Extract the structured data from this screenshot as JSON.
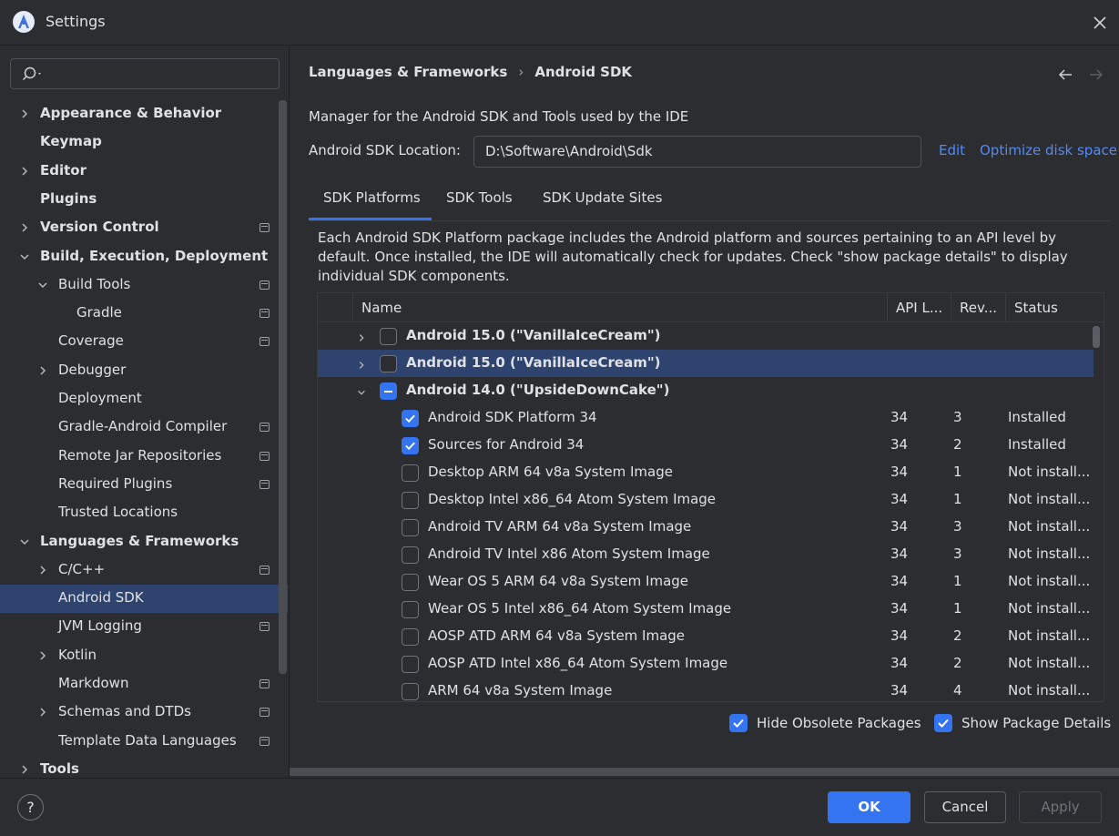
{
  "window": {
    "title": "Settings"
  },
  "search": {
    "placeholder": ""
  },
  "sidebar": {
    "items": [
      {
        "label": "Appearance & Behavior",
        "depth": 0,
        "arrow": "right",
        "bold": true,
        "badge": false
      },
      {
        "label": "Keymap",
        "depth": 0,
        "arrow": "none",
        "bold": true,
        "badge": false
      },
      {
        "label": "Editor",
        "depth": 0,
        "arrow": "right",
        "bold": true,
        "badge": false
      },
      {
        "label": "Plugins",
        "depth": 0,
        "arrow": "none",
        "bold": true,
        "badge": false
      },
      {
        "label": "Version Control",
        "depth": 0,
        "arrow": "right",
        "bold": true,
        "badge": true
      },
      {
        "label": "Build, Execution, Deployment",
        "depth": 0,
        "arrow": "down",
        "bold": true,
        "badge": false
      },
      {
        "label": "Build Tools",
        "depth": 1,
        "arrow": "down",
        "bold": false,
        "badge": true
      },
      {
        "label": "Gradle",
        "depth": 2,
        "arrow": "none",
        "bold": false,
        "badge": true
      },
      {
        "label": "Coverage",
        "depth": 1,
        "arrow": "none",
        "bold": false,
        "badge": true
      },
      {
        "label": "Debugger",
        "depth": 1,
        "arrow": "right",
        "bold": false,
        "badge": false
      },
      {
        "label": "Deployment",
        "depth": 1,
        "arrow": "none",
        "bold": false,
        "badge": false
      },
      {
        "label": "Gradle-Android Compiler",
        "depth": 1,
        "arrow": "none",
        "bold": false,
        "badge": true
      },
      {
        "label": "Remote Jar Repositories",
        "depth": 1,
        "arrow": "none",
        "bold": false,
        "badge": true
      },
      {
        "label": "Required Plugins",
        "depth": 1,
        "arrow": "none",
        "bold": false,
        "badge": true
      },
      {
        "label": "Trusted Locations",
        "depth": 1,
        "arrow": "none",
        "bold": false,
        "badge": false
      },
      {
        "label": "Languages & Frameworks",
        "depth": 0,
        "arrow": "down",
        "bold": true,
        "badge": false
      },
      {
        "label": "C/C++",
        "depth": 1,
        "arrow": "right",
        "bold": false,
        "badge": true
      },
      {
        "label": "Android SDK",
        "depth": 1,
        "arrow": "none",
        "bold": false,
        "badge": false,
        "selected": true
      },
      {
        "label": "JVM Logging",
        "depth": 1,
        "arrow": "none",
        "bold": false,
        "badge": true
      },
      {
        "label": "Kotlin",
        "depth": 1,
        "arrow": "right",
        "bold": false,
        "badge": false
      },
      {
        "label": "Markdown",
        "depth": 1,
        "arrow": "none",
        "bold": false,
        "badge": true
      },
      {
        "label": "Schemas and DTDs",
        "depth": 1,
        "arrow": "right",
        "bold": false,
        "badge": true
      },
      {
        "label": "Template Data Languages",
        "depth": 1,
        "arrow": "none",
        "bold": false,
        "badge": true
      },
      {
        "label": "Tools",
        "depth": 0,
        "arrow": "right",
        "bold": true,
        "badge": false
      }
    ]
  },
  "header": {
    "breadcrumb_parent": "Languages & Frameworks",
    "breadcrumb_sep": "›",
    "breadcrumb_current": "Android SDK"
  },
  "main": {
    "description": "Manager for the Android SDK and Tools used by the IDE",
    "location_label": "Android SDK Location:",
    "location_value": "D:\\Software\\Android\\Sdk",
    "edit_link": "Edit",
    "optimize_link": "Optimize disk space",
    "tabs": [
      {
        "label": "SDK Platforms",
        "active": true
      },
      {
        "label": "SDK Tools",
        "active": false
      },
      {
        "label": "SDK Update Sites",
        "active": false
      }
    ],
    "info_text": "Each Android SDK Platform package includes the Android platform and sources pertaining to an API level by default. Once installed, the IDE will automatically check for updates. Check \"show package details\" to display individual SDK components.",
    "table": {
      "columns": [
        "Name",
        "API L...",
        "Rev...",
        "Status"
      ],
      "rows": [
        {
          "type": "group",
          "name": "Android 15.0 (\"VanillaIceCream\")",
          "arrow": "right",
          "check": "none",
          "api": "",
          "rev": "",
          "status": ""
        },
        {
          "type": "group",
          "name": "Android 15.0 (\"VanillaIceCream\")",
          "arrow": "right",
          "check": "none",
          "api": "",
          "rev": "",
          "status": "",
          "selected": true
        },
        {
          "type": "group",
          "name": "Android 14.0 (\"UpsideDownCake\")",
          "arrow": "down",
          "check": "partial",
          "api": "",
          "rev": "",
          "status": ""
        },
        {
          "type": "item",
          "name": "Android SDK Platform 34",
          "check": "checked",
          "api": "34",
          "rev": "3",
          "status": "Installed"
        },
        {
          "type": "item",
          "name": "Sources for Android 34",
          "check": "checked",
          "api": "34",
          "rev": "2",
          "status": "Installed"
        },
        {
          "type": "item",
          "name": "Desktop ARM 64 v8a System Image",
          "check": "none",
          "api": "34",
          "rev": "1",
          "status": "Not install..."
        },
        {
          "type": "item",
          "name": "Desktop Intel x86_64 Atom System Image",
          "check": "none",
          "api": "34",
          "rev": "1",
          "status": "Not install..."
        },
        {
          "type": "item",
          "name": "Android TV ARM 64 v8a System Image",
          "check": "none",
          "api": "34",
          "rev": "3",
          "status": "Not install..."
        },
        {
          "type": "item",
          "name": "Android TV Intel x86 Atom System Image",
          "check": "none",
          "api": "34",
          "rev": "3",
          "status": "Not install..."
        },
        {
          "type": "item",
          "name": "Wear OS 5 ARM 64 v8a System Image",
          "check": "none",
          "api": "34",
          "rev": "1",
          "status": "Not install..."
        },
        {
          "type": "item",
          "name": "Wear OS 5 Intel x86_64 Atom System Image",
          "check": "none",
          "api": "34",
          "rev": "1",
          "status": "Not install..."
        },
        {
          "type": "item",
          "name": "AOSP ATD ARM 64 v8a System Image",
          "check": "none",
          "api": "34",
          "rev": "2",
          "status": "Not install..."
        },
        {
          "type": "item",
          "name": "AOSP ATD Intel x86_64 Atom System Image",
          "check": "none",
          "api": "34",
          "rev": "2",
          "status": "Not install..."
        },
        {
          "type": "item",
          "name": "ARM 64 v8a System Image",
          "check": "none",
          "api": "34",
          "rev": "4",
          "status": "Not install..."
        }
      ]
    },
    "hide_obsolete_label": "Hide Obsolete Packages",
    "hide_obsolete_checked": true,
    "show_details_label": "Show Package Details",
    "show_details_checked": true
  },
  "footer": {
    "help_label": "?",
    "ok_label": "OK",
    "cancel_label": "Cancel",
    "apply_label": "Apply"
  },
  "colors": {
    "background": "#2b2d30",
    "selection": "#2e436e",
    "accent": "#3574f0",
    "link": "#548af7",
    "text": "#dfe1e5"
  }
}
